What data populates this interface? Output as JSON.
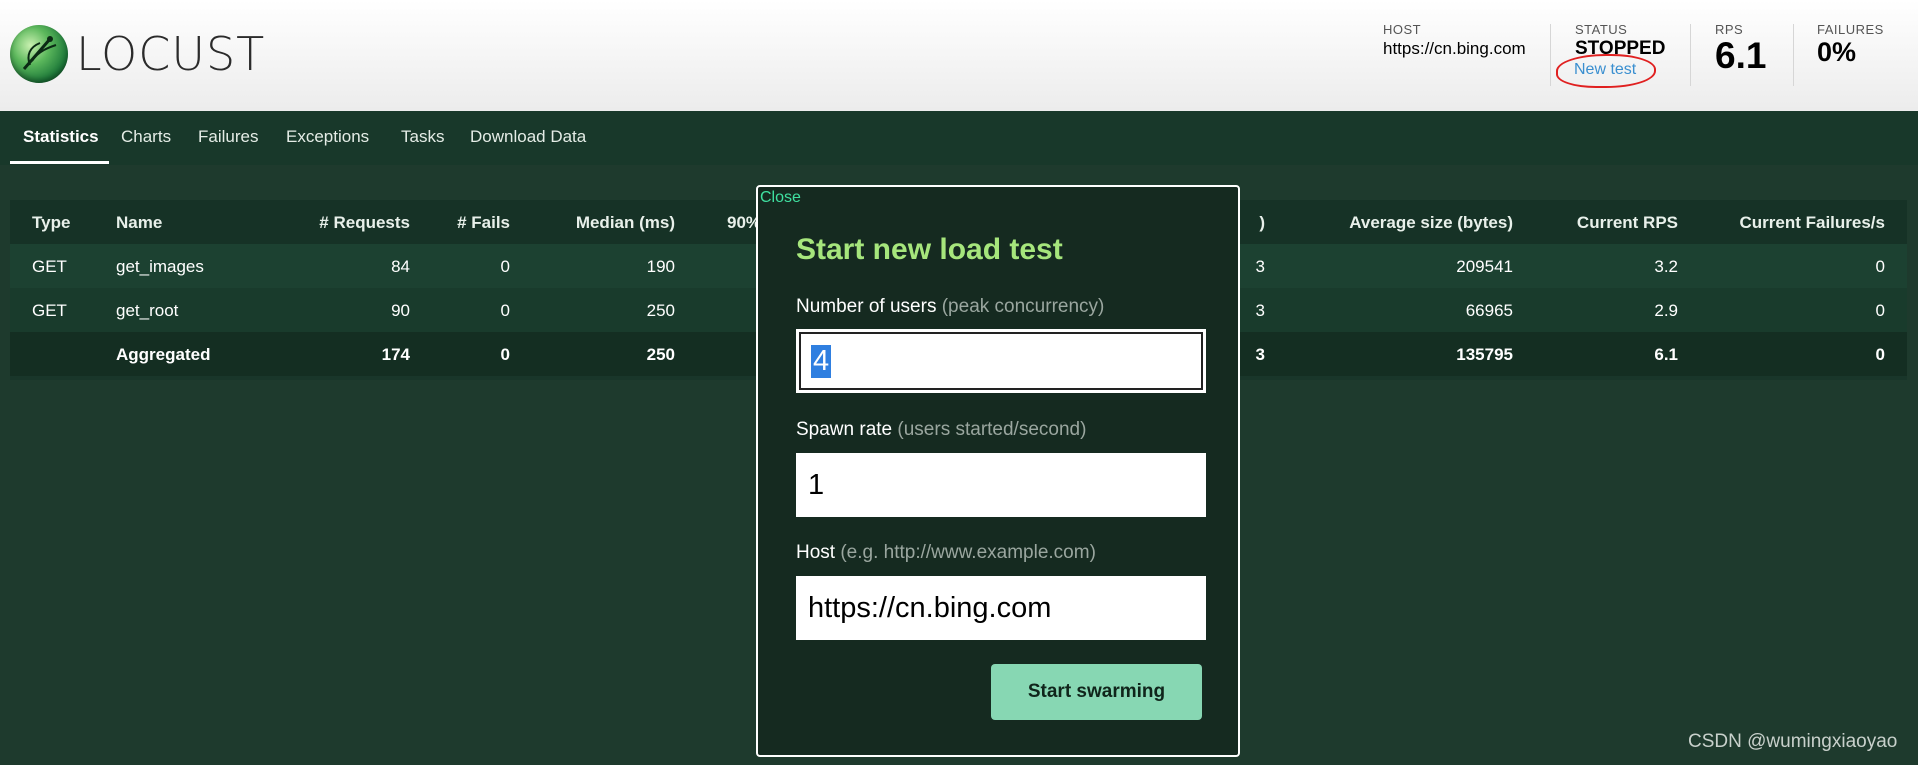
{
  "app": {
    "logo_text": "LOCUST"
  },
  "header": {
    "host_label": "HOST",
    "host_value": "https://cn.bing.com",
    "status_label": "STATUS",
    "status_value": "STOPPED",
    "new_test_label": "New test",
    "rps_label": "RPS",
    "rps_value": "6.1",
    "failures_label": "FAILURES",
    "failures_value": "0%"
  },
  "tabs": [
    {
      "label": "Statistics",
      "active": true
    },
    {
      "label": "Charts",
      "active": false
    },
    {
      "label": "Failures",
      "active": false
    },
    {
      "label": "Exceptions",
      "active": false
    },
    {
      "label": "Tasks",
      "active": false
    },
    {
      "label": "Download Data",
      "active": false
    }
  ],
  "table": {
    "headers": {
      "type": "Type",
      "name": "Name",
      "requests": "# Requests",
      "fails": "# Fails",
      "median": "Median (ms)",
      "p90_partial": "90%",
      "hidden_partial": ")",
      "avg_size": "Average size (bytes)",
      "current_rps": "Current RPS",
      "current_failures": "Current Failures/s"
    },
    "rows": [
      {
        "type": "GET",
        "name": "get_images",
        "requests": "84",
        "fails": "0",
        "median": "190",
        "hidden_partial": "3",
        "avg_size": "209541",
        "current_rps": "3.2",
        "current_failures": "0"
      },
      {
        "type": "GET",
        "name": "get_root",
        "requests": "90",
        "fails": "0",
        "median": "250",
        "hidden_partial": "3",
        "avg_size": "66965",
        "current_rps": "2.9",
        "current_failures": "0"
      }
    ],
    "aggregated": {
      "type": "",
      "name": "Aggregated",
      "requests": "174",
      "fails": "0",
      "median": "250",
      "hidden_partial": "3",
      "avg_size": "135795",
      "current_rps": "6.1",
      "current_failures": "0"
    }
  },
  "modal": {
    "close_label": "Close",
    "title": "Start new load test",
    "users_label": "Number of users",
    "users_hint": "(peak concurrency)",
    "users_value": "4",
    "spawn_label": "Spawn rate",
    "spawn_hint": "(users started/second)",
    "spawn_value": "1",
    "host_label": "Host",
    "host_hint": "(e.g. http://www.example.com)",
    "host_value": "https://cn.bing.com",
    "submit_label": "Start swarming"
  },
  "watermark": "CSDN @wumingxiaoyao",
  "colors": {
    "background": "#1e3a2d",
    "accent_title": "#a6e67c",
    "button": "#87d7b3",
    "link": "#3a8fd0",
    "close_link": "#3fe0a0",
    "annotation_red": "#e02020"
  },
  "icons": {
    "logo": "locust-logo-icon"
  }
}
